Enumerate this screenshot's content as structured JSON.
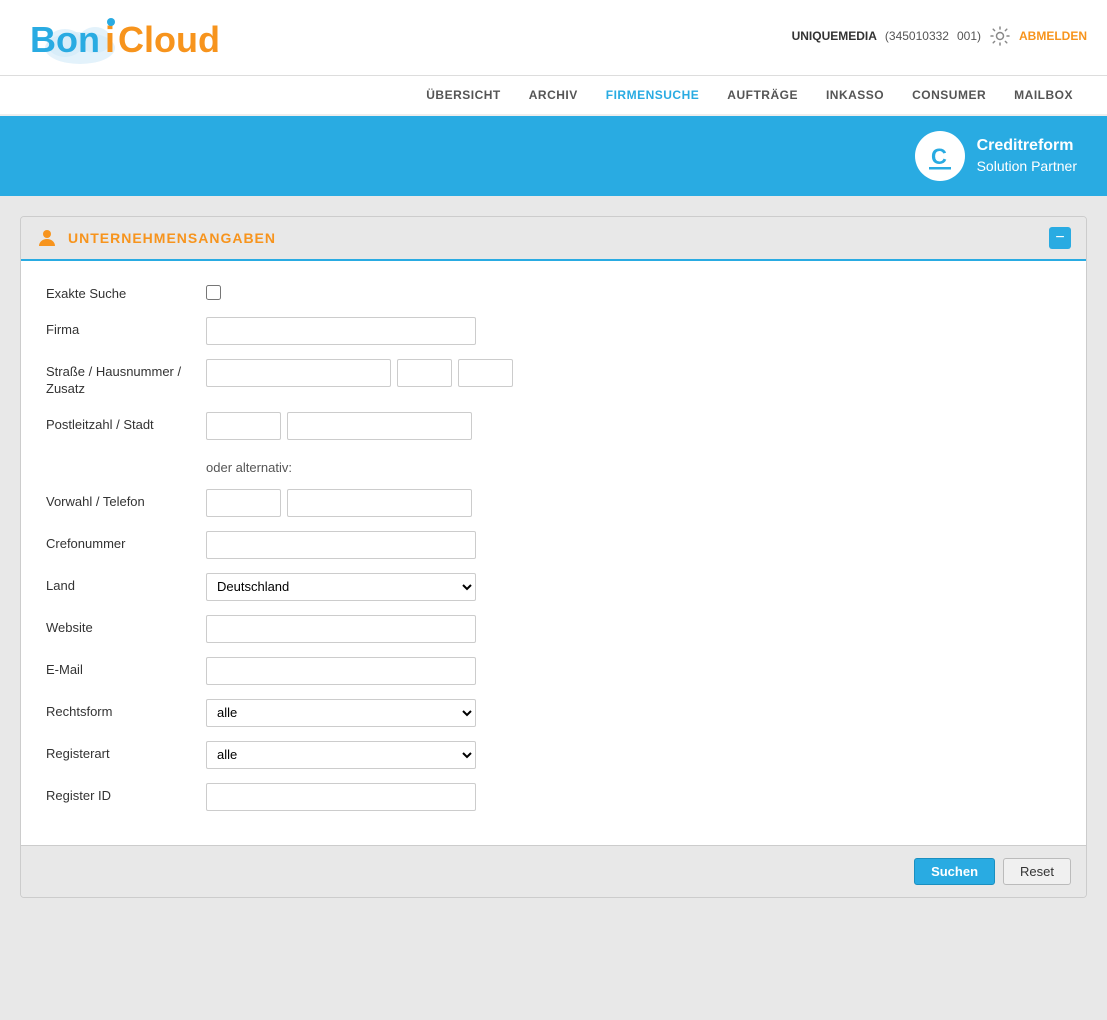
{
  "topbar": {
    "logo_bon": "Bon",
    "logo_i": "i",
    "logo_cloud": "Cloud",
    "user_label": "UNIQUEMEDIA",
    "user_id": "(345010332",
    "user_id2": "001)",
    "abmelden_label": "ABMELDEN",
    "settings_icon": "gear-icon"
  },
  "nav": {
    "items": [
      {
        "label": "ÜBERSICHT",
        "active": false
      },
      {
        "label": "ARCHIV",
        "active": false
      },
      {
        "label": "FIRMENSUCHE",
        "active": true
      },
      {
        "label": "AUFTRÄGE",
        "active": false
      },
      {
        "label": "INKASSO",
        "active": false
      },
      {
        "label": "CONSUMER",
        "active": false
      },
      {
        "label": "MAILBOX",
        "active": false
      }
    ]
  },
  "banner": {
    "creditreform_c": "C",
    "creditreform_line1": "Creditreform",
    "creditreform_line2": "Solution Partner"
  },
  "form": {
    "title": "UNTERNEHMENSANGABEN",
    "collapse_label": "−",
    "fields": {
      "exakte_suche_label": "Exakte Suche",
      "firma_label": "Firma",
      "strasse_label": "Straße / Hausnummer /\nZusatz",
      "strasse_label_line1": "Straße / Hausnummer /",
      "strasse_label_line2": "Zusatz",
      "plz_label": "Postleitzahl / Stadt",
      "oder_alternativ": "oder alternativ:",
      "vorwahl_label": "Vorwahl / Telefon",
      "crefonummer_label": "Crefonummer",
      "land_label": "Land",
      "land_value": "Deutschland",
      "website_label": "Website",
      "email_label": "E-Mail",
      "rechtsform_label": "Rechtsform",
      "rechtsform_value": "alle",
      "registerart_label": "Registerart",
      "registerart_value": "alle",
      "register_id_label": "Register ID"
    },
    "buttons": {
      "search_label": "Suchen",
      "reset_label": "Reset"
    }
  }
}
